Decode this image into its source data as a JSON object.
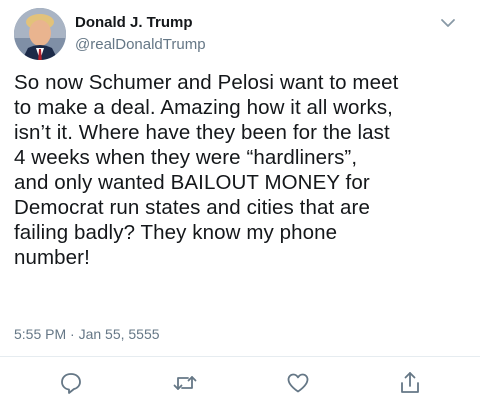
{
  "author": {
    "display_name": "Donald J. Trump",
    "handle": "@realDonaldTrump",
    "avatar_icon": "profile-photo"
  },
  "tweet": {
    "text": "So now Schumer and Pelosi want to meet\nto make a deal. Amazing how it all works,\nisn’t it. Where have they been for the last\n4 weeks when they were “hardliners”,\nand only wanted BAILOUT MONEY for\nDemocrat run states and cities that are\nfailing badly? They know my phone\nnumber!",
    "timestamp": "5:55 PM · Jan 55, 5555"
  },
  "actions": {
    "reply_icon": "reply-icon",
    "retweet_icon": "retweet-icon",
    "like_icon": "heart-icon",
    "share_icon": "share-icon"
  },
  "colors": {
    "text": "#14171a",
    "secondary": "#657786",
    "icon": "#657786",
    "divider": "#e6ecf0"
  }
}
